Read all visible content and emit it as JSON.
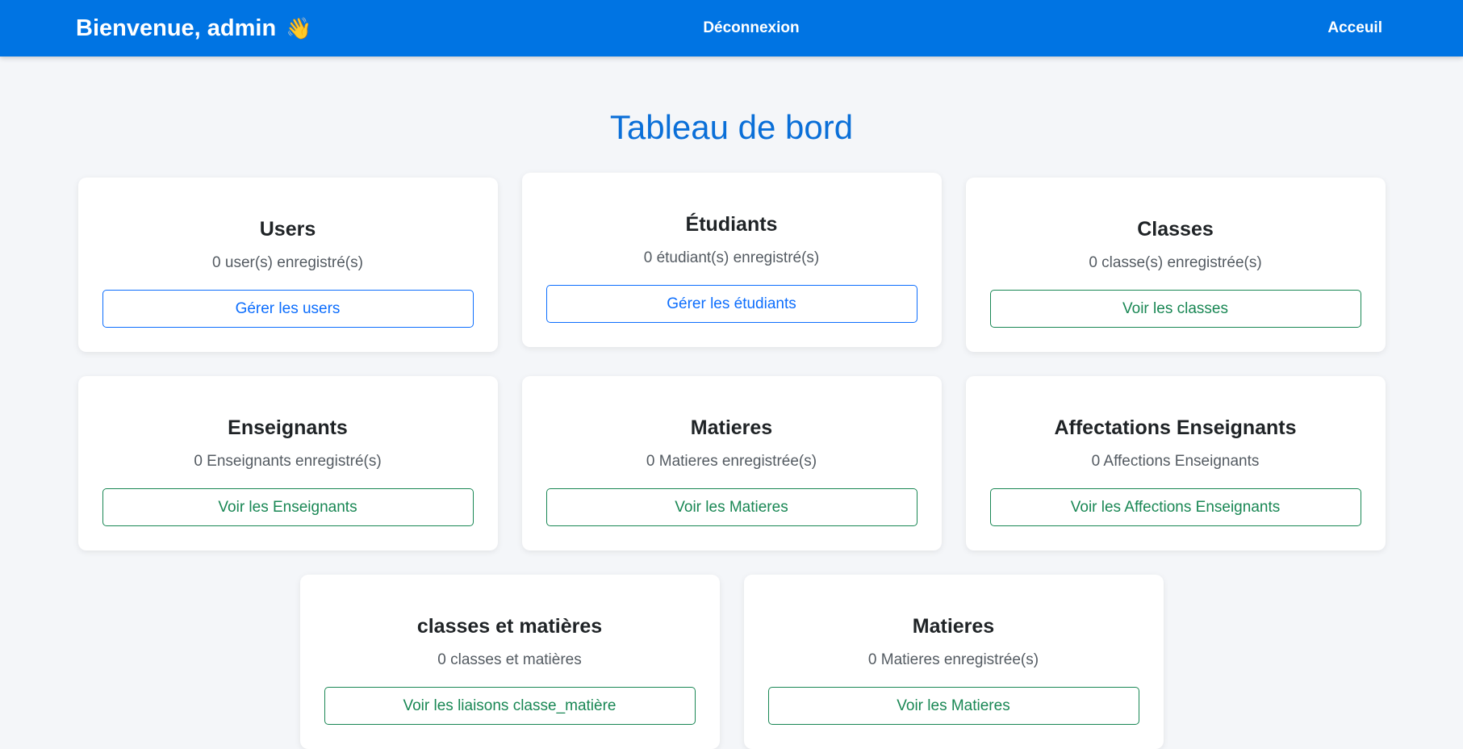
{
  "nav": {
    "welcome": "Bienvenue, admin",
    "wave_emoji": "👋",
    "logout": "Déconnexion",
    "home": "Acceuil"
  },
  "page": {
    "title": "Tableau de bord"
  },
  "cards": [
    {
      "title": "Users",
      "count_text": "0 user(s) enregistré(s)",
      "button": "Gérer les users",
      "style": "primary"
    },
    {
      "title": "Étudiants",
      "count_text": "0 étudiant(s) enregistré(s)",
      "button": "Gérer les étudiants",
      "style": "primary"
    },
    {
      "title": "Classes",
      "count_text": "0 classe(s) enregistrée(s)",
      "button": "Voir les classes",
      "style": "success"
    },
    {
      "title": "Enseignants",
      "count_text": "0 Enseignants enregistré(s)",
      "button": "Voir les Enseignants",
      "style": "success"
    },
    {
      "title": "Matieres",
      "count_text": "0 Matieres enregistrée(s)",
      "button": "Voir les Matieres",
      "style": "success"
    },
    {
      "title": "Affectations Enseignants",
      "count_text": "0 Affections Enseignants",
      "button": "Voir les Affections Enseignants",
      "style": "success"
    },
    {
      "title": "classes et matières",
      "count_text": "0 classes et matières",
      "button": "Voir les liaisons classe_matière",
      "style": "success"
    },
    {
      "title": "Matieres",
      "count_text": "0 Matieres enregistrée(s)",
      "button": "Voir les Matieres",
      "style": "success"
    }
  ],
  "colors": {
    "navbar": "#0074e3",
    "title": "#0a6fd8",
    "primary": "#0d6efd",
    "success": "#198754",
    "background": "#f4f6f9"
  }
}
